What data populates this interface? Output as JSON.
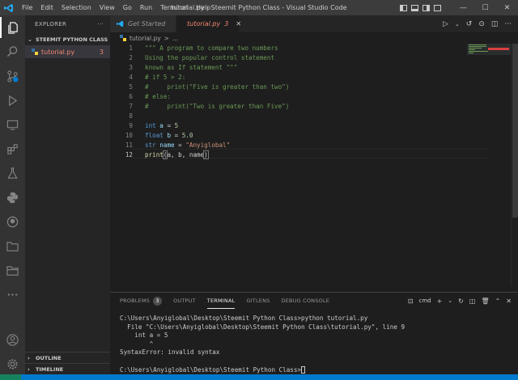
{
  "window": {
    "title": "tutorial.py - Steemit Python Class - Visual Studio Code",
    "menu": [
      "File",
      "Edit",
      "Selection",
      "View",
      "Go",
      "Run",
      "Terminal",
      "Help"
    ],
    "controls": {
      "minimize": "—",
      "maximize": "☐",
      "close": "✕"
    }
  },
  "activity_bar": {
    "icons": [
      "explorer-icon",
      "search-icon",
      "source-control-icon",
      "run-debug-icon",
      "remote-explorer-icon",
      "extensions-icon",
      "testing-icon",
      "python-icon",
      "github-icon",
      "project-manager-icon",
      "folder-icon",
      "more-icon",
      "account-icon",
      "settings-gear-icon"
    ]
  },
  "sidebar": {
    "title": "EXPLORER",
    "more": "···",
    "folder_name": "STEEMIT PYTHON CLASS",
    "files": [
      {
        "name": "tutorial.py",
        "problems": "3"
      }
    ],
    "outline": "OUTLINE",
    "timeline": "TIMELINE"
  },
  "tabs": [
    {
      "label": "Get Started",
      "active": false
    },
    {
      "label": "tutorial.py",
      "badge": "3",
      "active": true
    }
  ],
  "breadcrumb": {
    "file": "tutorial.py",
    "separator": ">",
    "rest": "..."
  },
  "editor": {
    "line_numbers": [
      "1",
      "2",
      "3",
      "4",
      "5",
      "6",
      "7",
      "8",
      "9",
      "10",
      "11",
      "12"
    ],
    "current_line": "12",
    "lines": {
      "l1": "\"\"\" A program to compare two numbers",
      "l2": "Using the popular control statement",
      "l3": "known as If statement \"\"\"",
      "l4": "# if 5 > 2:",
      "l5": "#     print(\"Five is greater than two\")",
      "l6": "# else:",
      "l7": "#     print(\"Two is greater than Five\")",
      "l9_type": "int",
      "l9_var": "a",
      "l9_op": " = ",
      "l9_val": "5",
      "l10_type": "float",
      "l10_var": "b",
      "l10_op": " = ",
      "l10_val": "5.0",
      "l11_type": "str",
      "l11_var": "name",
      "l11_op": " = ",
      "l11_val": "\"Anyiglobal\"",
      "l12_fn": "print",
      "l12_open": "(",
      "l12_args": "a, b, name",
      "l12_close": ")"
    }
  },
  "panel": {
    "tabs": [
      {
        "label": "PROBLEMS",
        "badge": "3"
      },
      {
        "label": "OUTPUT"
      },
      {
        "label": "TERMINAL",
        "active": true
      },
      {
        "label": "GITLENS"
      },
      {
        "label": "DEBUG CONSOLE"
      }
    ],
    "shell": "cmd",
    "terminal_lines": [
      "C:\\Users\\Anyiglobal\\Desktop\\Steemit Python Class>python tutorial.py",
      "  File \"C:\\Users\\Anyiglobal\\Desktop\\Steemit Python Class\\tutorial.py\", line 9",
      "    int a = 5",
      "        ^",
      "SyntaxError: invalid syntax",
      "",
      "C:\\Users\\Anyiglobal\\Desktop\\Steemit Python Class>"
    ]
  },
  "colors": {
    "accent": "#007acc",
    "error": "#f48771",
    "comment": "#6a9955",
    "keyword": "#569cd6",
    "string": "#ce9178"
  }
}
